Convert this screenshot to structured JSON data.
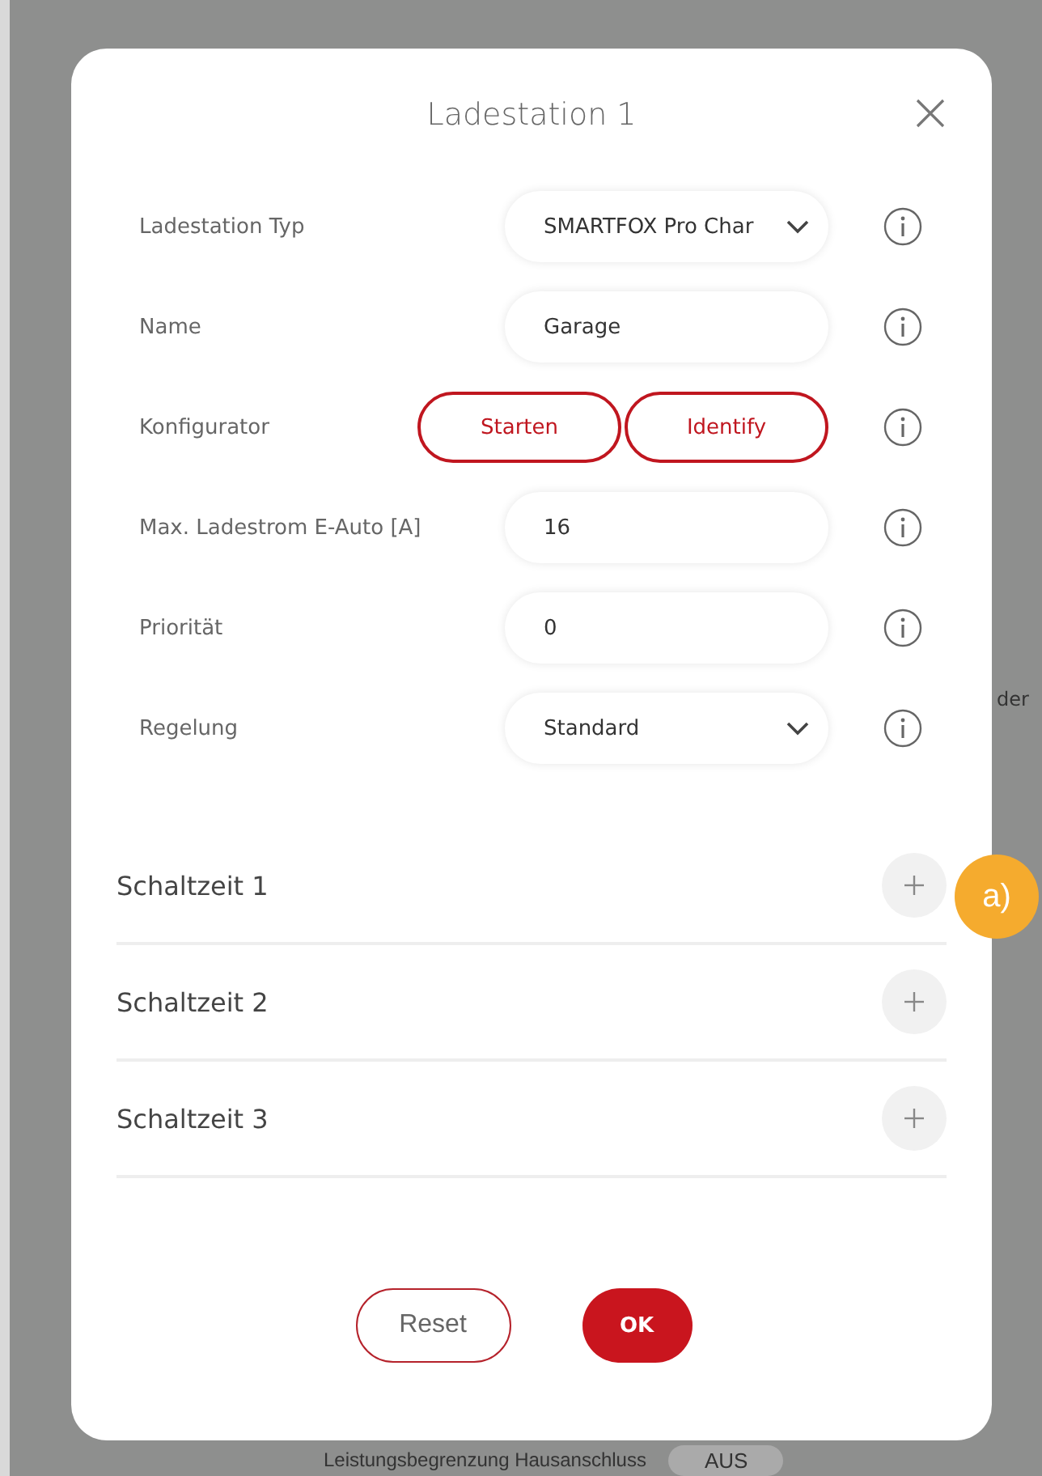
{
  "background": {
    "side_text": "der",
    "footer_label": "Leistungsbegrenzung Hausanschluss",
    "footer_value": "AUS"
  },
  "dialog": {
    "title": "Ladestation 1",
    "fields": [
      {
        "label": "Ladestation Typ",
        "kind": "select",
        "value": "SMARTFOX Pro Char"
      },
      {
        "label": "Name",
        "kind": "input",
        "value": "Garage"
      },
      {
        "label": "Konfigurator",
        "kind": "buttons",
        "buttons": [
          "Starten",
          "Identify"
        ]
      },
      {
        "label": "Max. Ladestrom E-Auto [A]",
        "kind": "input",
        "value": "16"
      },
      {
        "label": "Priorität",
        "kind": "input",
        "value": "0"
      },
      {
        "label": "Regelung",
        "kind": "select",
        "value": "Standard"
      }
    ],
    "sections": [
      {
        "title": "Schaltzeit 1",
        "expanded": false
      },
      {
        "title": "Schaltzeit 2",
        "expanded": false
      },
      {
        "title": "Schaltzeit 3",
        "expanded": false
      }
    ],
    "buttons": {
      "reset": "Reset",
      "ok": "OK"
    }
  },
  "annotation": "a)"
}
